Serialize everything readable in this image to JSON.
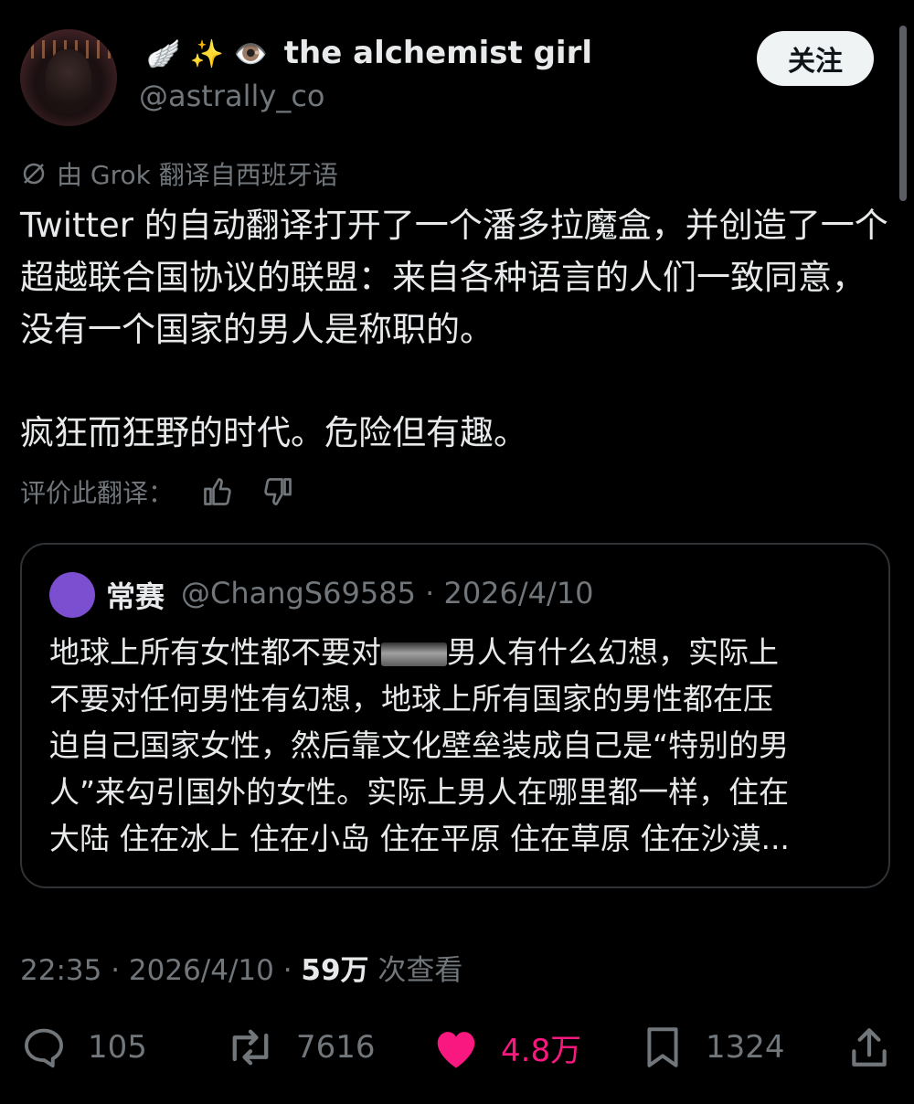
{
  "author": {
    "emojis": "🪽 ✨ 👁️",
    "display_name": "the alchemist girl",
    "handle": "@astrally_co",
    "follow_label": "关注"
  },
  "translation": {
    "notice": "由 Grok 翻译自西班牙语",
    "rate_label": "评价此翻译："
  },
  "tweet": {
    "paragraphs": [
      "Twitter 的自动翻译打开了一个潘多拉魔盒，并创造了一个超越联合国协议的联盟：来自各种语言的人们一致同意，没有一个国家的男人是称职的。",
      "疯狂而狂野的时代。危险但有趣。"
    ]
  },
  "quote": {
    "display_name": "常赛",
    "meta": "@ChangS69585 · 2026/4/10",
    "line1_before": "地球上所有女性都不要对",
    "line1_after": "男人有什么幻想，实际上",
    "line2": "不要对任何男性有幻想，地球上所有国家的男性都在压",
    "line3": "迫自己国家女性，然后靠文化壁垒装成自己是“特别的男",
    "line4": "人”来勾引国外的女性。实际上男人在哪里都一样，住在",
    "line5": "大陆 住在冰上 住在小岛 住在平原 住在草原 住在沙漠..."
  },
  "meta": {
    "time_date": "22:35 · 2026/4/10 ·",
    "views": "59万",
    "views_label": "次查看"
  },
  "actions": {
    "replies": "105",
    "reposts": "7616",
    "likes": "4.8万",
    "bookmarks": "1324"
  },
  "colors": {
    "background": "#000000",
    "text": "#e7e9ea",
    "muted": "#71767b",
    "like": "#f91880",
    "quote_avatar": "#7b4fcf"
  }
}
